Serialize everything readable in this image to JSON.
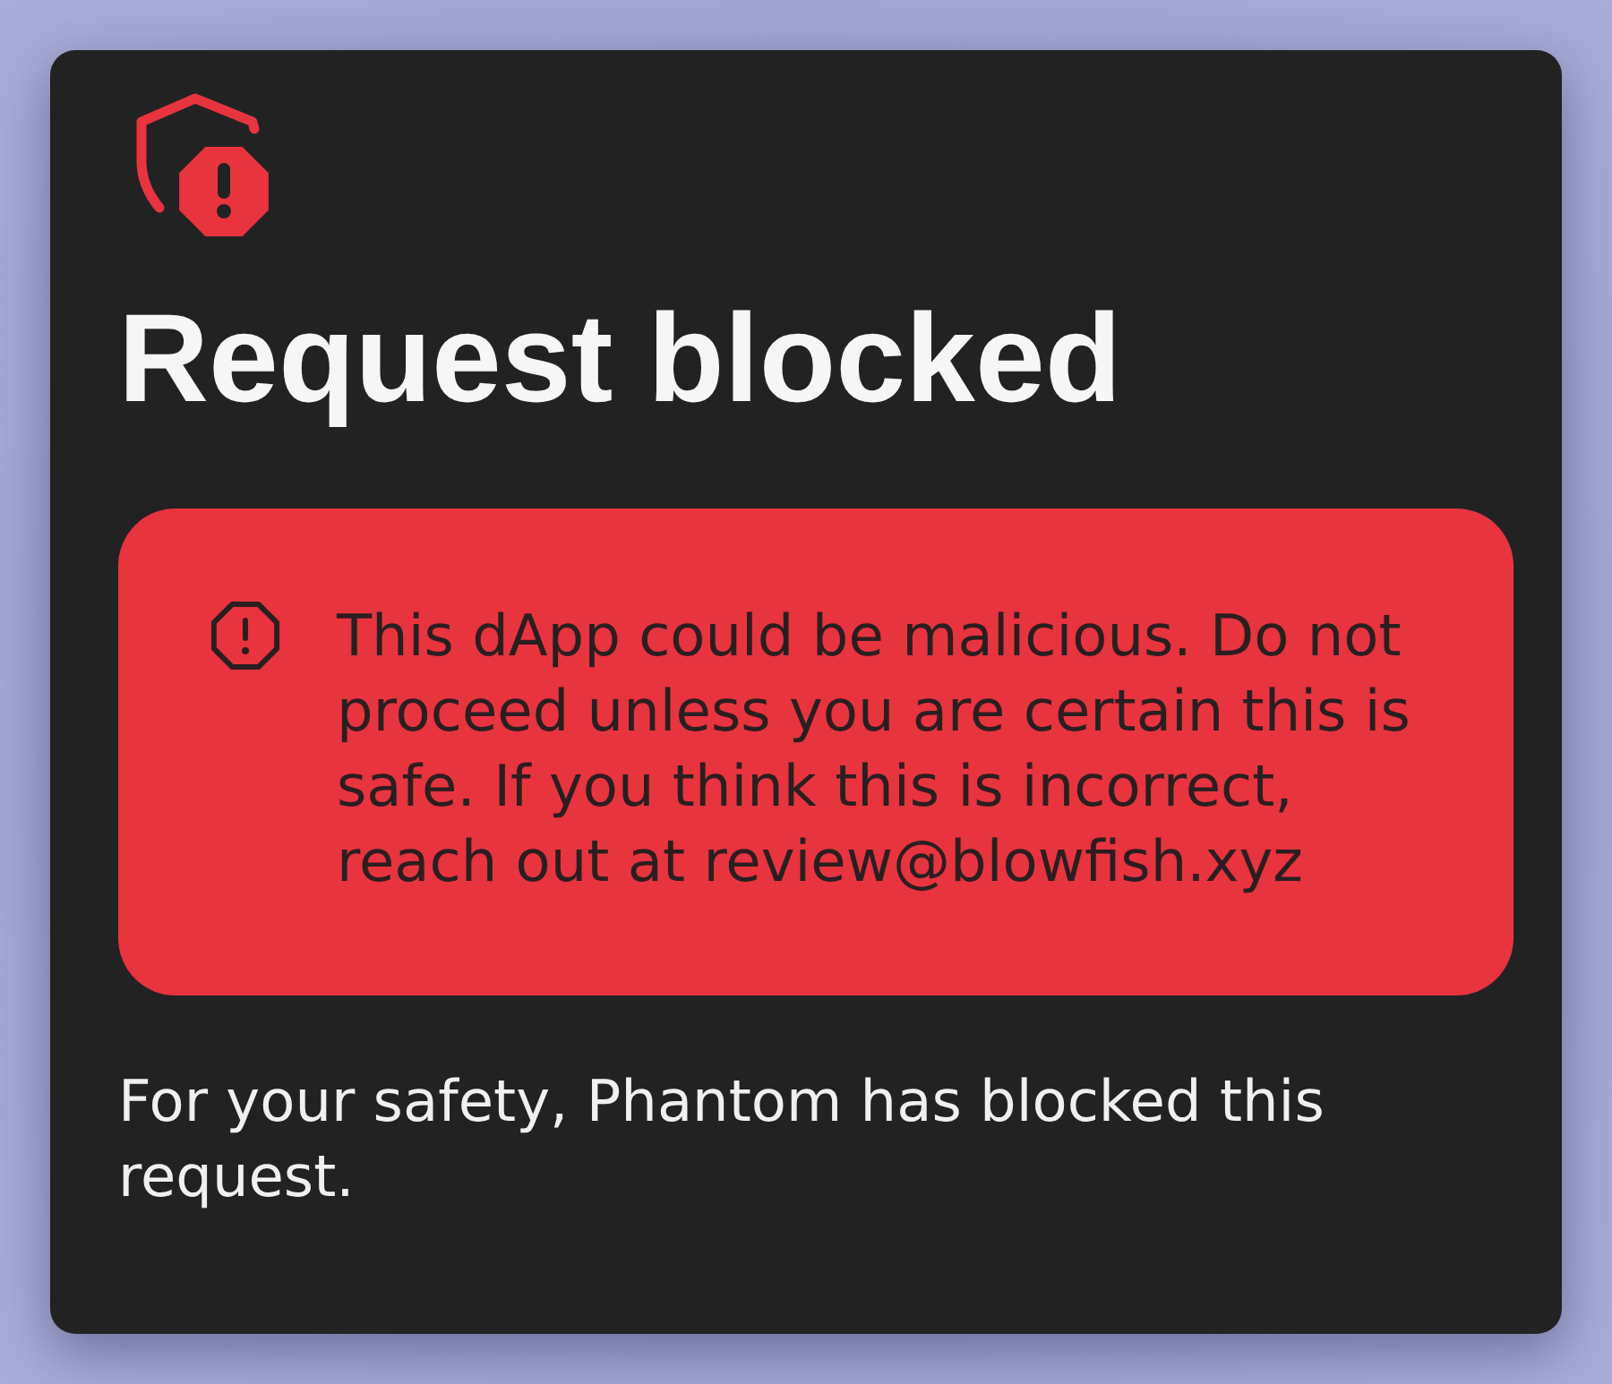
{
  "dialog": {
    "title": "Request blocked",
    "warning": {
      "message": "This dApp could be malicious. Do not proceed unless you are certain this is safe. If you think this is incorrect, reach out at review@blowfish.xyz"
    },
    "footer": "For your safety, Phantom has blocked this request."
  }
}
